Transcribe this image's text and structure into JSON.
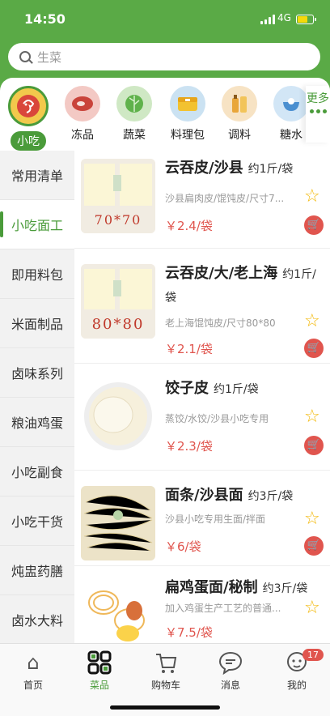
{
  "status": {
    "time": "14:50",
    "network": "4G"
  },
  "search": {
    "placeholder": "生菜"
  },
  "categories": [
    {
      "label": "小吃",
      "icon": "snack-icon",
      "active": true
    },
    {
      "label": "冻品",
      "icon": "meat-icon"
    },
    {
      "label": "蔬菜",
      "icon": "vegetable-icon"
    },
    {
      "label": "料理包",
      "icon": "lunchbox-icon"
    },
    {
      "label": "调料",
      "icon": "bottle-icon"
    },
    {
      "label": "糖水",
      "icon": "dessert-icon"
    }
  ],
  "more_label": "更多",
  "sidebar": [
    {
      "label": "常用清单"
    },
    {
      "label": "小吃面工",
      "active": true
    },
    {
      "label": "即用料包"
    },
    {
      "label": "米面制品"
    },
    {
      "label": "卤味系列"
    },
    {
      "label": "粮油鸡蛋"
    },
    {
      "label": "小吃副食"
    },
    {
      "label": "小吃干货"
    },
    {
      "label": "炖盅药膳"
    },
    {
      "label": "卤水大料"
    }
  ],
  "products": [
    {
      "name": "云吞皮/沙县",
      "unit": "约1斤/袋",
      "desc": "沙县扁肉皮/馄饨皮/尺寸7...",
      "price": "￥2.4/袋",
      "thumb_text": "70*70"
    },
    {
      "name": "云吞皮/大/老上海",
      "unit": "约1斤/袋",
      "desc": "老上海馄饨皮/尺寸80*80",
      "price": "￥2.1/袋",
      "thumb_text": "80*80"
    },
    {
      "name": "饺子皮",
      "unit": "约1斤/袋",
      "desc": "蒸饺/水饺/沙县小吃专用",
      "price": "￥2.3/袋",
      "thumb_text": ""
    },
    {
      "name": "面条/沙县面",
      "unit": "约3斤/袋",
      "desc": "沙县小吃专用生面/拌面",
      "price": "￥6/袋",
      "thumb_text": ""
    },
    {
      "name": "扁鸡蛋面/秘制",
      "unit": "约3斤/袋",
      "desc": "加入鸡蛋生产工艺的普通...",
      "price": "￥7.5/袋",
      "thumb_text": ""
    }
  ],
  "tabbar": [
    {
      "label": "首页"
    },
    {
      "label": "菜品",
      "active": true
    },
    {
      "label": "购物车"
    },
    {
      "label": "消息"
    },
    {
      "label": "我的",
      "badge": "17"
    }
  ],
  "colors": {
    "brand": "#5aaa46",
    "price": "#e0554e",
    "star": "#f2b705"
  }
}
